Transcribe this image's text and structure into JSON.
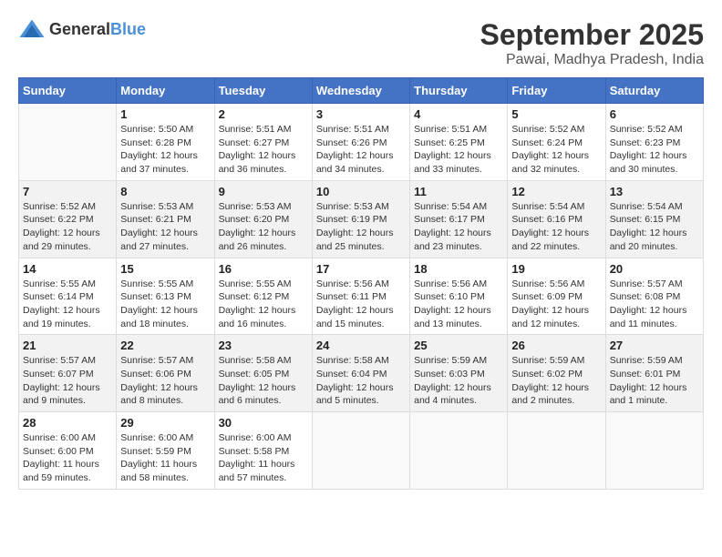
{
  "header": {
    "logo_general": "General",
    "logo_blue": "Blue",
    "month_title": "September 2025",
    "location": "Pawai, Madhya Pradesh, India"
  },
  "days_of_week": [
    "Sunday",
    "Monday",
    "Tuesday",
    "Wednesday",
    "Thursday",
    "Friday",
    "Saturday"
  ],
  "weeks": [
    [
      {
        "day": "",
        "info": ""
      },
      {
        "day": "1",
        "info": "Sunrise: 5:50 AM\nSunset: 6:28 PM\nDaylight: 12 hours\nand 37 minutes."
      },
      {
        "day": "2",
        "info": "Sunrise: 5:51 AM\nSunset: 6:27 PM\nDaylight: 12 hours\nand 36 minutes."
      },
      {
        "day": "3",
        "info": "Sunrise: 5:51 AM\nSunset: 6:26 PM\nDaylight: 12 hours\nand 34 minutes."
      },
      {
        "day": "4",
        "info": "Sunrise: 5:51 AM\nSunset: 6:25 PM\nDaylight: 12 hours\nand 33 minutes."
      },
      {
        "day": "5",
        "info": "Sunrise: 5:52 AM\nSunset: 6:24 PM\nDaylight: 12 hours\nand 32 minutes."
      },
      {
        "day": "6",
        "info": "Sunrise: 5:52 AM\nSunset: 6:23 PM\nDaylight: 12 hours\nand 30 minutes."
      }
    ],
    [
      {
        "day": "7",
        "info": "Sunrise: 5:52 AM\nSunset: 6:22 PM\nDaylight: 12 hours\nand 29 minutes."
      },
      {
        "day": "8",
        "info": "Sunrise: 5:53 AM\nSunset: 6:21 PM\nDaylight: 12 hours\nand 27 minutes."
      },
      {
        "day": "9",
        "info": "Sunrise: 5:53 AM\nSunset: 6:20 PM\nDaylight: 12 hours\nand 26 minutes."
      },
      {
        "day": "10",
        "info": "Sunrise: 5:53 AM\nSunset: 6:19 PM\nDaylight: 12 hours\nand 25 minutes."
      },
      {
        "day": "11",
        "info": "Sunrise: 5:54 AM\nSunset: 6:17 PM\nDaylight: 12 hours\nand 23 minutes."
      },
      {
        "day": "12",
        "info": "Sunrise: 5:54 AM\nSunset: 6:16 PM\nDaylight: 12 hours\nand 22 minutes."
      },
      {
        "day": "13",
        "info": "Sunrise: 5:54 AM\nSunset: 6:15 PM\nDaylight: 12 hours\nand 20 minutes."
      }
    ],
    [
      {
        "day": "14",
        "info": "Sunrise: 5:55 AM\nSunset: 6:14 PM\nDaylight: 12 hours\nand 19 minutes."
      },
      {
        "day": "15",
        "info": "Sunrise: 5:55 AM\nSunset: 6:13 PM\nDaylight: 12 hours\nand 18 minutes."
      },
      {
        "day": "16",
        "info": "Sunrise: 5:55 AM\nSunset: 6:12 PM\nDaylight: 12 hours\nand 16 minutes."
      },
      {
        "day": "17",
        "info": "Sunrise: 5:56 AM\nSunset: 6:11 PM\nDaylight: 12 hours\nand 15 minutes."
      },
      {
        "day": "18",
        "info": "Sunrise: 5:56 AM\nSunset: 6:10 PM\nDaylight: 12 hours\nand 13 minutes."
      },
      {
        "day": "19",
        "info": "Sunrise: 5:56 AM\nSunset: 6:09 PM\nDaylight: 12 hours\nand 12 minutes."
      },
      {
        "day": "20",
        "info": "Sunrise: 5:57 AM\nSunset: 6:08 PM\nDaylight: 12 hours\nand 11 minutes."
      }
    ],
    [
      {
        "day": "21",
        "info": "Sunrise: 5:57 AM\nSunset: 6:07 PM\nDaylight: 12 hours\nand 9 minutes."
      },
      {
        "day": "22",
        "info": "Sunrise: 5:57 AM\nSunset: 6:06 PM\nDaylight: 12 hours\nand 8 minutes."
      },
      {
        "day": "23",
        "info": "Sunrise: 5:58 AM\nSunset: 6:05 PM\nDaylight: 12 hours\nand 6 minutes."
      },
      {
        "day": "24",
        "info": "Sunrise: 5:58 AM\nSunset: 6:04 PM\nDaylight: 12 hours\nand 5 minutes."
      },
      {
        "day": "25",
        "info": "Sunrise: 5:59 AM\nSunset: 6:03 PM\nDaylight: 12 hours\nand 4 minutes."
      },
      {
        "day": "26",
        "info": "Sunrise: 5:59 AM\nSunset: 6:02 PM\nDaylight: 12 hours\nand 2 minutes."
      },
      {
        "day": "27",
        "info": "Sunrise: 5:59 AM\nSunset: 6:01 PM\nDaylight: 12 hours\nand 1 minute."
      }
    ],
    [
      {
        "day": "28",
        "info": "Sunrise: 6:00 AM\nSunset: 6:00 PM\nDaylight: 11 hours\nand 59 minutes."
      },
      {
        "day": "29",
        "info": "Sunrise: 6:00 AM\nSunset: 5:59 PM\nDaylight: 11 hours\nand 58 minutes."
      },
      {
        "day": "30",
        "info": "Sunrise: 6:00 AM\nSunset: 5:58 PM\nDaylight: 11 hours\nand 57 minutes."
      },
      {
        "day": "",
        "info": ""
      },
      {
        "day": "",
        "info": ""
      },
      {
        "day": "",
        "info": ""
      },
      {
        "day": "",
        "info": ""
      }
    ]
  ]
}
